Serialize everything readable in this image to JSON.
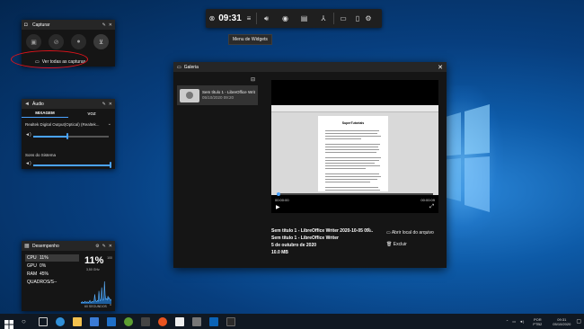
{
  "gamebar": {
    "time": "09:31",
    "tooltip": "Menu de Widgets",
    "icons": [
      "xbox-icon",
      "widget-menu-icon",
      "audio-icon",
      "capture-icon",
      "performance-icon",
      "social-icon",
      "resource-icon",
      "settings-icon"
    ]
  },
  "capture": {
    "title": "Capturar",
    "buttons": [
      "screenshot-icon",
      "record-last-icon",
      "record-icon",
      "mic-icon"
    ],
    "link": "Ver todas as capturas"
  },
  "audio": {
    "title": "Áudio",
    "tabs": [
      "MIXAGEM",
      "VOZ"
    ],
    "device": "Realtek Digital Output(Optical) (Realtek...",
    "device_volume": 0.45,
    "system_sounds_label": "Sons do Sistema",
    "system_volume": 1.0
  },
  "performance": {
    "title": "Desempenho",
    "rows": [
      {
        "label": "CPU",
        "value": "11%"
      },
      {
        "label": "GPU",
        "value": "0%"
      },
      {
        "label": "RAM",
        "value": "45%"
      },
      {
        "label": "QUADROS/S",
        "value": "--"
      }
    ],
    "big_value": "11%",
    "freq": "3,50 GHz",
    "y_max": "100",
    "y_min": "0",
    "time_label": "60 SEGUNDOS",
    "cpu_series": [
      4,
      3,
      5,
      3,
      4,
      3,
      6,
      4,
      3,
      5,
      4,
      3,
      5,
      8,
      4,
      3,
      6,
      5,
      4,
      7,
      22,
      9,
      6,
      5,
      8,
      6,
      30,
      12,
      7,
      9,
      38,
      14,
      8,
      10,
      52,
      20,
      10,
      12,
      9,
      18,
      11,
      14,
      9,
      8,
      11
    ]
  },
  "gallery": {
    "title": "Galeria",
    "item_title": "Sem título 1 - LibreOffice Writ",
    "item_date": "05/10/2020 09:20",
    "doc_heading": "SuperTutoriais",
    "player_time_start": "00:00:00",
    "player_time_end": "00:00:09",
    "detail_title": "Sem título 1 - LibreOffice Writer 2020-10-05 09...",
    "detail_app": "Sem título 1 - LibreOffice Writer",
    "detail_date": "5 de outubro de 2020",
    "detail_size": "10.0 MB",
    "action_open": "Abrir local do arquivo",
    "action_delete": "Excluir"
  },
  "taskbar": {
    "icons": [
      "start-icon",
      "search-icon",
      "taskview-icon",
      "edge-icon",
      "explorer-icon",
      "store-icon",
      "mail-icon",
      "xbox-app-icon",
      "media-icon",
      "music-icon",
      "writer-icon",
      "calculator-icon",
      "photos-icon",
      "gamebar-icon"
    ],
    "lang": "POR",
    "lang_sub": "PTB2",
    "time": "09:31",
    "date": "05/10/2020"
  }
}
